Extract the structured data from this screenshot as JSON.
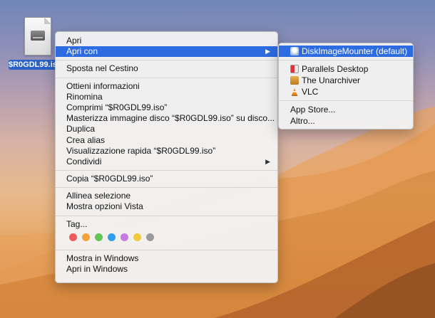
{
  "desktop": {
    "file_name": "$R0GDL99.iso"
  },
  "context_menu": {
    "group1": [
      "Apri",
      "Apri con"
    ],
    "group2": [
      "Sposta nel Cestino"
    ],
    "group3": [
      "Ottieni informazioni",
      "Rinomina",
      "Comprimi “$R0GDL99.iso”",
      "Masterizza immagine disco “$R0GDL99.iso” su disco...",
      "Duplica",
      "Crea alias",
      "Visualizzazione rapida “$R0GDL99.iso”",
      "Condividi"
    ],
    "group4": [
      "Copia “$R0GDL99.iso”"
    ],
    "group5": [
      "Allinea selezione",
      "Mostra opzioni Vista"
    ],
    "tags_label": "Tag...",
    "tag_colors": [
      "#f05a5a",
      "#f4a33a",
      "#62c554",
      "#2f9df0",
      "#c77be0",
      "#f2c93a",
      "#9a9a9a"
    ],
    "group7": [
      "Mostra in Windows",
      "Apri in Windows"
    ],
    "highlight_color": "#2d6be0"
  },
  "submenu": {
    "default_app": "DiskImageMounter (default)",
    "apps": [
      "Parallels Desktop",
      "The Unarchiver",
      "VLC"
    ],
    "extra": [
      "App Store...",
      "Altro..."
    ]
  }
}
